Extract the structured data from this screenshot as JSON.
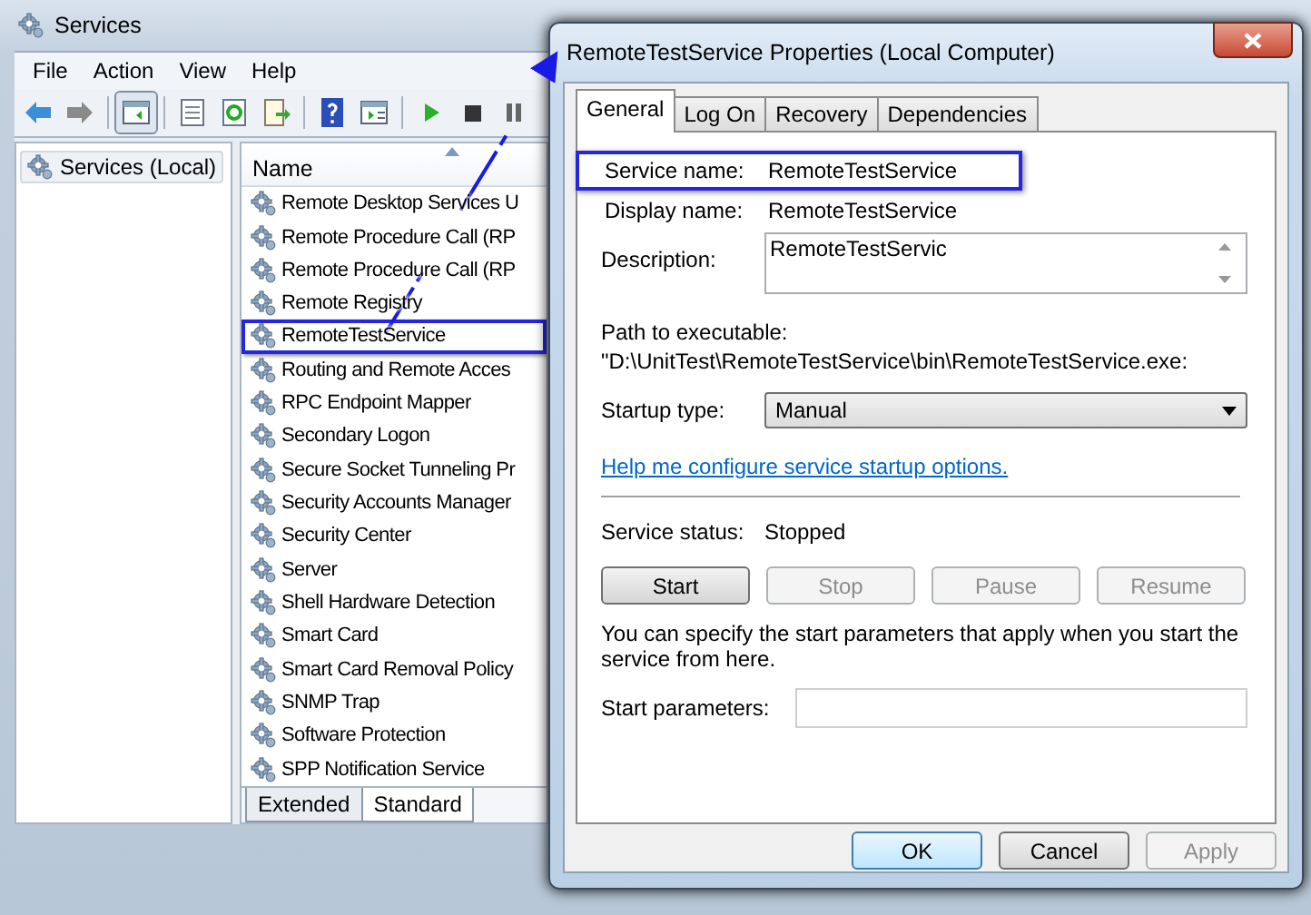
{
  "main_window": {
    "title": "Services",
    "menu": [
      "File",
      "Action",
      "View",
      "Help"
    ],
    "tree": [
      {
        "label": "Services (Local)",
        "selected": true
      }
    ],
    "list_header": "Name",
    "services": [
      {
        "name": "Remote Desktop Services U",
        "highlighted": false
      },
      {
        "name": "Remote Procedure Call (RP",
        "highlighted": false
      },
      {
        "name": "Remote Procedure Call (RP",
        "highlighted": false
      },
      {
        "name": "Remote Registry",
        "highlighted": false
      },
      {
        "name": "RemoteTestService",
        "highlighted": true
      },
      {
        "name": "Routing and Remote Acces",
        "highlighted": false
      },
      {
        "name": "RPC Endpoint Mapper",
        "highlighted": false
      },
      {
        "name": "Secondary Logon",
        "highlighted": false
      },
      {
        "name": "Secure Socket Tunneling Pr",
        "highlighted": false
      },
      {
        "name": "Security Accounts Manager",
        "highlighted": false
      },
      {
        "name": "Security Center",
        "highlighted": false
      },
      {
        "name": "Server",
        "highlighted": false
      },
      {
        "name": "Shell Hardware Detection",
        "highlighted": false
      },
      {
        "name": "Smart Card",
        "highlighted": false
      },
      {
        "name": "Smart Card Removal Policy",
        "highlighted": false
      },
      {
        "name": "SNMP Trap",
        "highlighted": false
      },
      {
        "name": "Software Protection",
        "highlighted": false
      },
      {
        "name": "SPP Notification Service",
        "highlighted": false
      }
    ],
    "view_tabs": [
      {
        "label": "Extended",
        "selected": false
      },
      {
        "label": "Standard",
        "selected": true
      }
    ]
  },
  "dialog": {
    "title": "RemoteTestService Properties (Local Computer)",
    "tabs": [
      {
        "label": "General",
        "selected": true
      },
      {
        "label": "Log On",
        "selected": false
      },
      {
        "label": "Recovery",
        "selected": false
      },
      {
        "label": "Dependencies",
        "selected": false
      }
    ],
    "fields": [
      {
        "label": "Service name:",
        "value": "RemoteTestService",
        "highlighted": true
      },
      {
        "label": "Display name:",
        "value": "RemoteTestService",
        "highlighted": false
      }
    ],
    "description": {
      "label": "Description:",
      "value": "RemoteTestServic"
    },
    "path": {
      "label": "Path to executable:",
      "value": "\"D:\\UnitTest\\RemoteTestService\\bin\\RemoteTestService.exe:"
    },
    "startup": {
      "label": "Startup type:",
      "value": "Manual"
    },
    "help_link": "Help me configure service startup options.",
    "status": {
      "label": "Service status:",
      "value": "Stopped"
    },
    "service_buttons": [
      {
        "label": "Start",
        "disabled": false
      },
      {
        "label": "Stop",
        "disabled": true
      },
      {
        "label": "Pause",
        "disabled": true
      },
      {
        "label": "Resume",
        "disabled": true
      }
    ],
    "note": "You can specify the start parameters that apply when you start the service from here.",
    "start_parameters": {
      "label": "Start parameters:"
    },
    "buttons": [
      {
        "label": "OK",
        "disabled": false,
        "default": true
      },
      {
        "label": "Cancel",
        "disabled": false,
        "default": false
      },
      {
        "label": "Apply",
        "disabled": true,
        "default": false
      }
    ]
  }
}
